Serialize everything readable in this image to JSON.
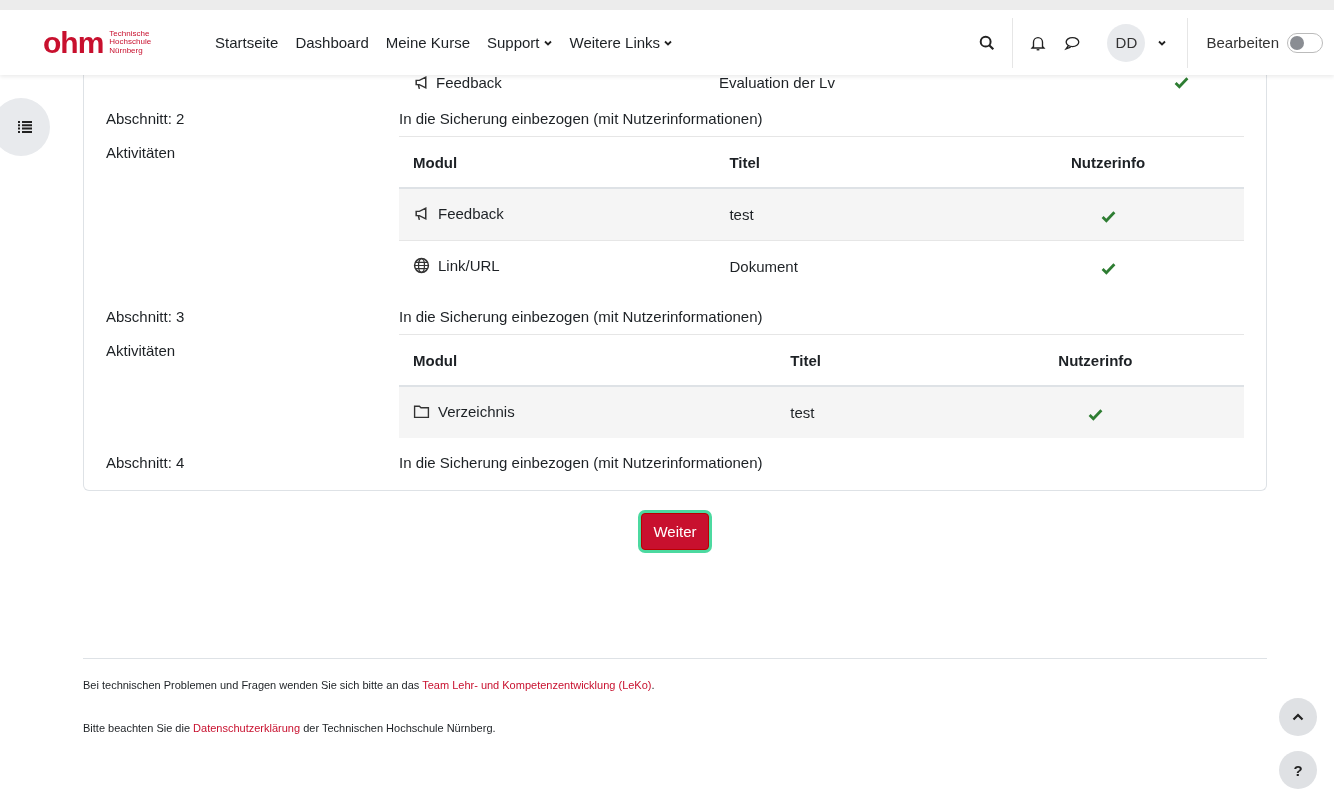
{
  "header": {
    "logo": {
      "mark": "ohm",
      "lines": [
        "Technische",
        "Hochschule",
        "Nürnberg"
      ]
    },
    "nav": [
      {
        "label": "Startseite",
        "dropdown": false
      },
      {
        "label": "Dashboard",
        "dropdown": false
      },
      {
        "label": "Meine Kurse",
        "dropdown": false
      },
      {
        "label": "Support",
        "dropdown": true
      },
      {
        "label": "Weitere Links",
        "dropdown": true
      }
    ],
    "avatar": "DD",
    "edit_toggle": {
      "label": "Bearbeiten",
      "on": false
    }
  },
  "partial_row": {
    "module": "Feedback",
    "kind": "feedback",
    "title": "Evaluation der Lv",
    "userinfo": true
  },
  "sections": [
    {
      "label": "Abschnitt: 2",
      "status": "In die Sicherung einbezogen (mit Nutzerinformationen)",
      "activities_label": "Aktivitäten",
      "columns": [
        "Modul",
        "Titel",
        "Nutzerinfo"
      ],
      "rows": [
        {
          "module": "Feedback",
          "kind": "feedback",
          "title": "test",
          "userinfo": true
        },
        {
          "module": "Link/URL",
          "kind": "url",
          "title": "Dokument",
          "userinfo": true
        }
      ]
    },
    {
      "label": "Abschnitt: 3",
      "status": "In die Sicherung einbezogen (mit Nutzerinformationen)",
      "activities_label": "Aktivitäten",
      "columns": [
        "Modul",
        "Titel",
        "Nutzerinfo"
      ],
      "rows": [
        {
          "module": "Verzeichnis",
          "kind": "folder",
          "title": "test",
          "userinfo": true
        }
      ]
    },
    {
      "label": "Abschnitt: 4",
      "status": "In die Sicherung einbezogen (mit Nutzerinformationen)"
    }
  ],
  "continue_button": "Weiter",
  "footer": [
    {
      "before": "Bei technischen Problemen und Fragen wenden Sie sich bitte an das ",
      "link": "Team Lehr- und Kompetenzentwicklung (LeKo)",
      "after": "."
    },
    {
      "before": "Bitte beachten Sie die ",
      "link": "Datenschutzerklärung",
      "after": " der Technischen Hochschule Nürnberg."
    }
  ],
  "help_button": "?"
}
